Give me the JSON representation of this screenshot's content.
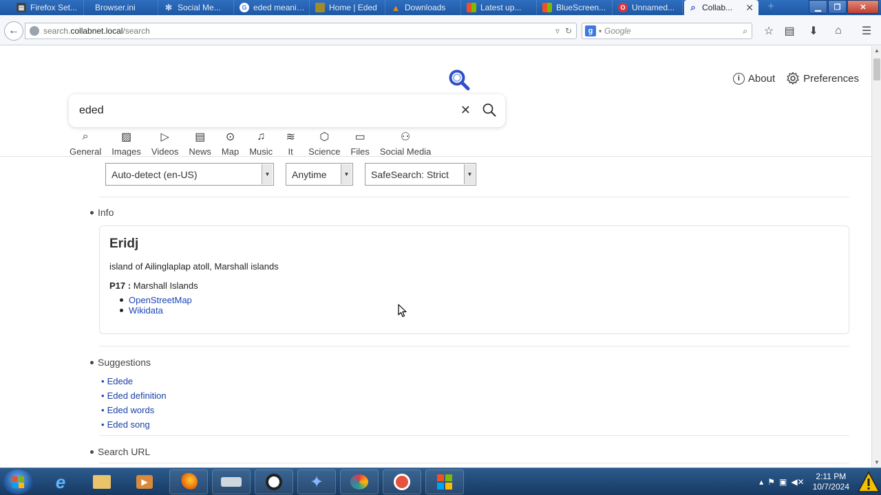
{
  "browser": {
    "tabs": [
      {
        "label": "Firefox Set...",
        "favicon_color": "#444444",
        "favicon": "firefox-settings-icon"
      },
      {
        "label": "Browser.ini",
        "favicon_color": "#2b5aa8",
        "favicon": "page-icon"
      },
      {
        "label": "Social Me...",
        "favicon_color": "#4a7fd1",
        "favicon": "snowflake-icon"
      },
      {
        "label": "eded meaning",
        "favicon_color": "#ffffff",
        "favicon": "google-icon"
      },
      {
        "label": "Home | Eded",
        "favicon_color": "#a08a2a",
        "favicon": "folder-icon"
      },
      {
        "label": "Downloads",
        "favicon_color": "#e08a1a",
        "favicon": "warning-icon"
      },
      {
        "label": "Latest up...",
        "favicon_color": "#d24726",
        "favicon": "windows-icon"
      },
      {
        "label": "BlueScreen...",
        "favicon_color": "#d24726",
        "favicon": "windows-icon"
      },
      {
        "label": "Unnamed...",
        "favicon_color": "#d9363e",
        "favicon": "opera-icon"
      },
      {
        "label": "Collab...",
        "favicon_color": "#3050c8",
        "favicon": "search-icon"
      }
    ],
    "active_tab_close": "✕",
    "new_tab": "+",
    "url": {
      "protocol": "search.",
      "domain": "collabnet.local",
      "path": "/search"
    },
    "search_engine_letter": "g",
    "search_placeholder": "Google"
  },
  "page": {
    "about_label": "About",
    "preferences_label": "Preferences",
    "query": "eded",
    "categories": [
      {
        "label": "General",
        "icon": "search-icon"
      },
      {
        "label": "Images",
        "icon": "image-icon"
      },
      {
        "label": "Videos",
        "icon": "play-icon"
      },
      {
        "label": "News",
        "icon": "newspaper-icon"
      },
      {
        "label": "Map",
        "icon": "pin-icon"
      },
      {
        "label": "Music",
        "icon": "music-icon"
      },
      {
        "label": "It",
        "icon": "layers-icon"
      },
      {
        "label": "Science",
        "icon": "cube-icon"
      },
      {
        "label": "Files",
        "icon": "inbox-icon"
      },
      {
        "label": "Social Media",
        "icon": "people-icon"
      }
    ],
    "filters": {
      "language": "Auto-detect (en-US)",
      "time": "Anytime",
      "safesearch": "SafeSearch: Strict"
    },
    "info": {
      "section_label": "Info",
      "title": "Eridj",
      "description": "island of Ailinglaplap atoll, Marshall islands",
      "attr_key": "P17 :",
      "attr_value": "Marshall Islands",
      "links": [
        "OpenStreetMap",
        "Wikidata"
      ]
    },
    "suggestions": {
      "section_label": "Suggestions",
      "items": [
        "Edede",
        "Eded definition",
        "Eded words",
        "Eded song"
      ]
    },
    "search_url_label": "Search URL"
  },
  "taskbar": {
    "time": "2:11 PM",
    "date": "10/7/2024"
  },
  "colors": {
    "accent": "#3050c8",
    "link": "#1a45b5"
  }
}
